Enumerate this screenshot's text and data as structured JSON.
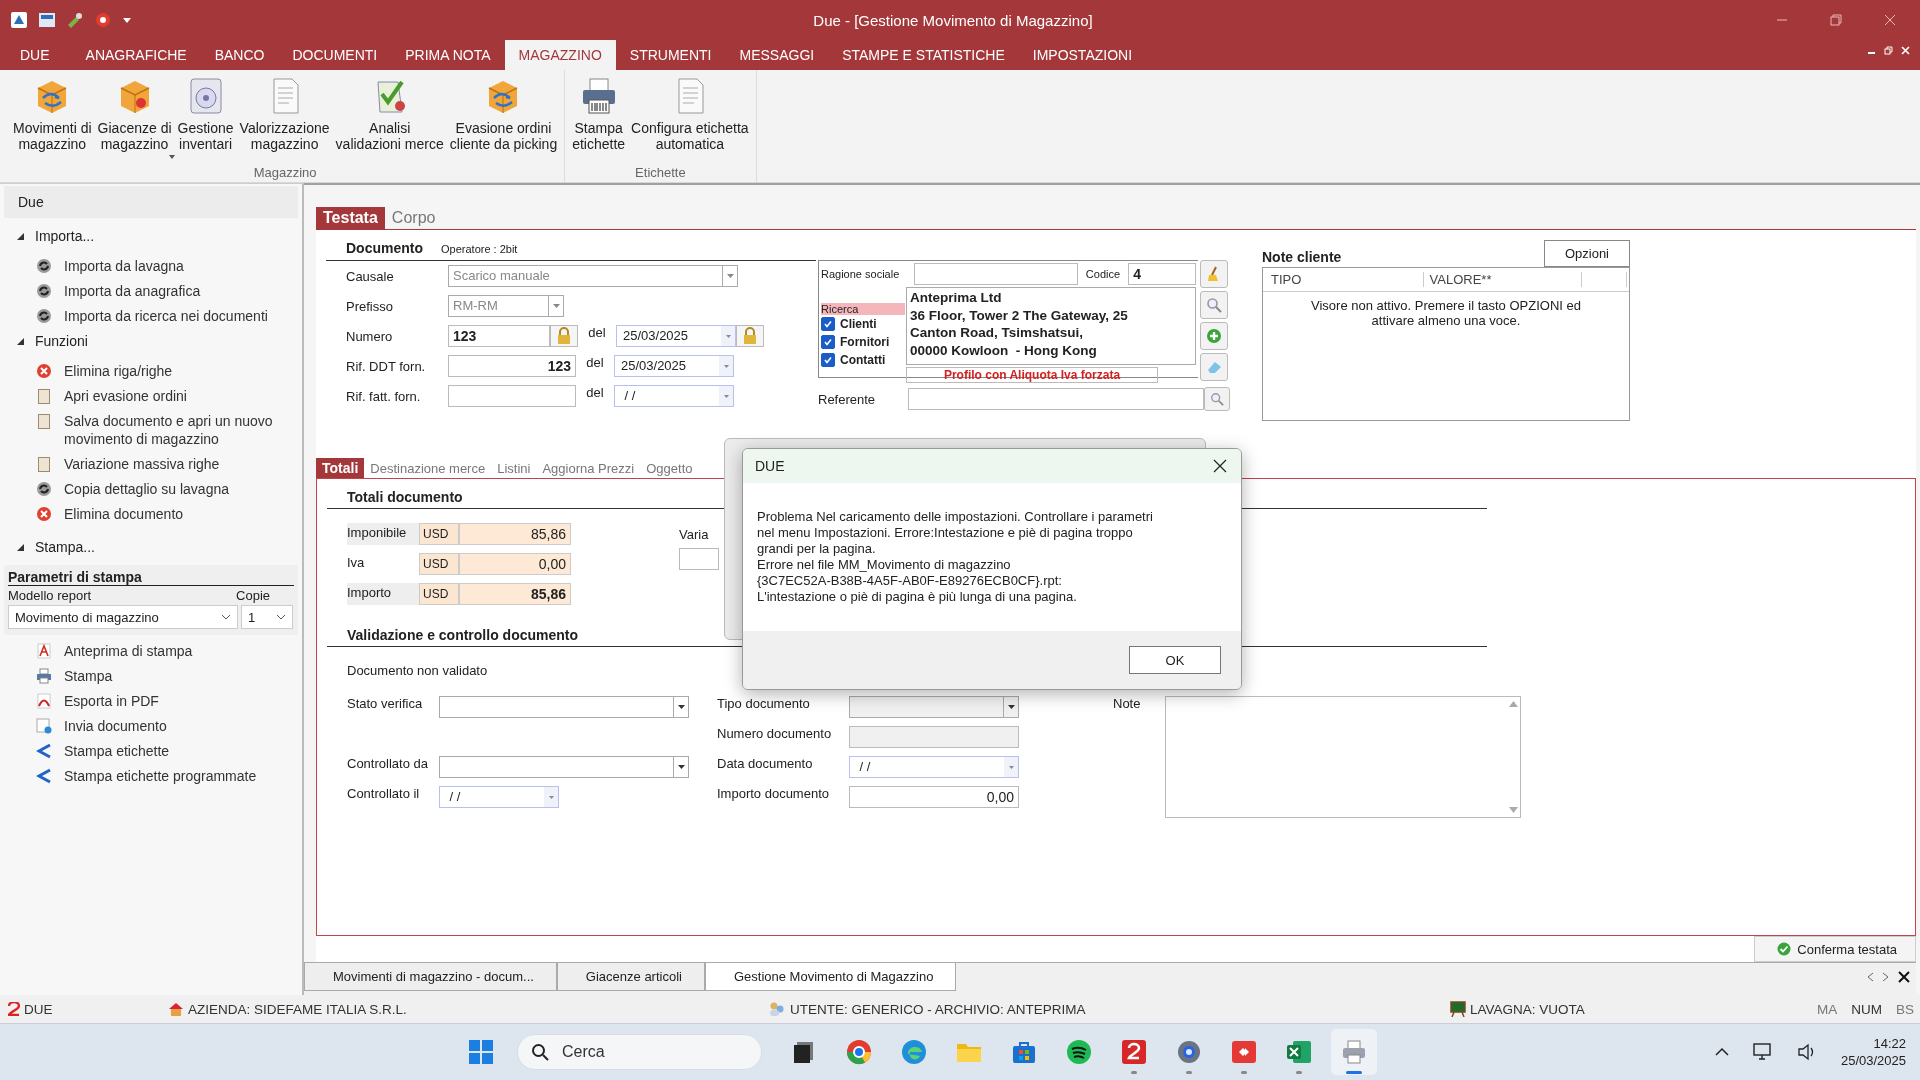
{
  "window": {
    "title": "Due - [Gestione Movimento di Magazzino]"
  },
  "menu_tabs": [
    {
      "label": "DUE",
      "selected": false
    },
    {
      "label": "ANAGRAFICHE",
      "selected": false
    },
    {
      "label": "BANCO",
      "selected": false
    },
    {
      "label": "DOCUMENTI",
      "selected": false
    },
    {
      "label": "PRIMA NOTA",
      "selected": false
    },
    {
      "label": "MAGAZZINO",
      "selected": true
    },
    {
      "label": "STRUMENTI",
      "selected": false
    },
    {
      "label": "MESSAGGI",
      "selected": false
    },
    {
      "label": "STAMPE E STATISTICHE",
      "selected": false
    },
    {
      "label": "IMPOSTAZIONI",
      "selected": false
    }
  ],
  "ribbon": [
    {
      "label": "Magazzino",
      "buttons": [
        {
          "label": "Movimenti di\nmagazzino",
          "kind": "cube"
        },
        {
          "label": "Giacenze di\nmagazzino",
          "kind": "cube-drop"
        },
        {
          "label": "Gestione\ninventari",
          "kind": "disc"
        },
        {
          "label": "Valorizzazione\nmagazzino",
          "kind": "doc"
        },
        {
          "label": "Analisi\nvalidazioni merce",
          "kind": "check"
        },
        {
          "label": "Evasione ordini\ncliente da picking",
          "kind": "cube"
        }
      ]
    },
    {
      "label": "Etichette",
      "buttons": [
        {
          "label": "Stampa\netichette",
          "kind": "printer"
        },
        {
          "label": "Configura etichetta\nautomatica",
          "kind": "doc"
        }
      ]
    }
  ],
  "sidebar": {
    "header": "Due",
    "sections": [
      {
        "label": "Importa...",
        "expanded": true,
        "items": [
          {
            "label": "Importa da lavagna",
            "kind": "sync"
          },
          {
            "label": "Importa da anagrafica",
            "kind": "sync"
          },
          {
            "label": "Importa da ricerca nei documenti",
            "kind": "sync"
          }
        ]
      },
      {
        "label": "Funzioni",
        "expanded": true,
        "items": [
          {
            "label": "Elimina riga/righe",
            "kind": "delete"
          },
          {
            "label": "Apri evasione ordini",
            "kind": "clipboard"
          },
          {
            "label": "Salva documento e apri un nuovo movimento di magazzino",
            "kind": "clipboard"
          },
          {
            "label": "Variazione massiva righe",
            "kind": "clipboard"
          },
          {
            "label": "Copia dettaglio su lavagna",
            "kind": "sync"
          },
          {
            "label": "Elimina documento",
            "kind": "delete"
          }
        ]
      },
      {
        "label": "Stampa...",
        "expanded": true
      }
    ],
    "print_params": {
      "title": "Parametri di stampa",
      "model_label": "Modello report",
      "model": "Movimento di magazzino",
      "copies_label": "Copie",
      "copies": "1"
    },
    "print_items": [
      {
        "label": "Anteprima di stampa",
        "kind": "preview"
      },
      {
        "label": "Stampa",
        "kind": "print"
      },
      {
        "label": "Esporta in PDF",
        "kind": "pdf"
      },
      {
        "label": "Invia documento",
        "kind": "send"
      },
      {
        "label": "Stampa etichette",
        "kind": "label"
      },
      {
        "label": "Stampa etichette programmate",
        "kind": "label"
      }
    ]
  },
  "doc_tabs": [
    {
      "label": "Testata",
      "selected": true
    },
    {
      "label": "Corpo",
      "selected": false
    }
  ],
  "documento": {
    "title": "Documento",
    "operator": "Operatore : 2bit",
    "fields": [
      {
        "label": "Causale",
        "kind": "combo",
        "value": "Scarico manuale"
      },
      {
        "label": "Prefisso",
        "kind": "combo-short",
        "value": "RM-RM"
      },
      {
        "label": "Numero",
        "kind": "locked",
        "value": "123",
        "date_label": "del",
        "date": "25/03/2025"
      },
      {
        "label": "Rif. DDT forn.",
        "kind": "number",
        "value": "123",
        "date_label": "del",
        "date": "25/03/2025"
      },
      {
        "label": "Rif. fatt. forn.",
        "kind": "number",
        "date_label": "del",
        "date": " / /"
      }
    ]
  },
  "customer": {
    "name_label": "Ragione sociale",
    "code_label": "Codice",
    "code": "4",
    "search_label": "Ricerca",
    "filters": [
      {
        "label": "Clienti",
        "checked": true
      },
      {
        "label": "Fornitori",
        "checked": true
      },
      {
        "label": "Contatti",
        "checked": true
      }
    ],
    "address": [
      "Anteprima Ltd",
      "36 Floor, Tower 2 The Gateway, 25",
      "Canton Road, Tsimshatsui,",
      "00000 Kowloon  - Hong Kong"
    ],
    "profile": "Profilo con Aliquota Iva forzata",
    "referente_label": "Referente"
  },
  "note_cliente": {
    "title": "Note cliente",
    "options_button": "Opzioni",
    "columns": [
      "TIPO",
      "VALORE**"
    ],
    "message": "Visore non attivo. Premere il tasto OPZIONI ed attivare almeno una voce."
  },
  "sub_tabs": [
    {
      "label": "Totali",
      "selected": true
    },
    {
      "label": "Destinazione merce",
      "selected": false
    },
    {
      "label": "Listini",
      "selected": false
    },
    {
      "label": "Aggiorna Prezzi",
      "selected": false
    },
    {
      "label": "Oggetto",
      "selected": false
    }
  ],
  "totali": {
    "title": "Totali documento",
    "rows": [
      {
        "label": "Imponibile",
        "currency": "USD",
        "value": "85,86",
        "kind": "plain"
      },
      {
        "label": "Iva",
        "currency": "USD",
        "value": "0,00",
        "kind": "plain"
      },
      {
        "label": "Importo",
        "currency": "USD",
        "value": "85,86",
        "kind": "total"
      }
    ],
    "side_label": "Varia"
  },
  "validazione": {
    "title": "Validazione e controllo documento",
    "status": "Documento non validato",
    "stato_label": "Stato verifica",
    "controllato_da_label": "Controllato da",
    "controllato_il_label": "Controllato il",
    "controllato_il": " / /",
    "tipo_label": "Tipo documento",
    "numero_label": "Numero documento",
    "data_label": "Data documento",
    "data": " / /",
    "importo_label": "Importo documento",
    "importo": "0,00",
    "note_label": "Note"
  },
  "confirm_button": "Conferma testata",
  "open_tabs": [
    {
      "label": "Movimenti di magazzino - docum...",
      "selected": false
    },
    {
      "label": "Giacenze articoli",
      "selected": false
    },
    {
      "label": "Gestione Movimento di Magazzino",
      "selected": true
    }
  ],
  "status_bar": {
    "app": "DUE",
    "company": "AZIENDA: SIDEFAME ITALIA S.R.L.",
    "user": "UTENTE: GENERICO - ARCHIVIO: ANTEPRIMA",
    "board": "LAVAGNA: VUOTA",
    "indicators": [
      "MA",
      "NUM",
      "BS"
    ]
  },
  "dialog": {
    "title": "DUE",
    "lines": [
      "Problema Nel caricamento delle impostazioni. Controllare i parametri",
      "nel menu Impostazioni. Errore:Intestazione e piè di pagina troppo",
      "grandi per la pagina.",
      "Errore nel file MM_Movimento di magazzino",
      "{3C7EC52A-B38B-4A5F-AB0F-E89276ECB0CF}.rpt:",
      "L'intestazione o piè di pagina è più lunga di una pagina."
    ],
    "ok_button": "OK"
  },
  "taskbar": {
    "search_placeholder": "Cerca",
    "time": "14:22",
    "date": "25/03/2025",
    "apps": [
      {
        "kind": "files-stack",
        "running": false,
        "selected": false
      },
      {
        "kind": "chrome",
        "running": false,
        "selected": false
      },
      {
        "kind": "edge",
        "running": false,
        "selected": false
      },
      {
        "kind": "folder",
        "running": false,
        "selected": false
      },
      {
        "kind": "store",
        "running": false,
        "selected": false
      },
      {
        "kind": "spotify",
        "running": false,
        "selected": false
      },
      {
        "kind": "due",
        "running": true,
        "selected": false
      },
      {
        "kind": "gear",
        "running": true,
        "selected": false
      },
      {
        "kind": "remote",
        "running": true,
        "selected": false
      },
      {
        "kind": "excel",
        "running": true,
        "selected": false
      },
      {
        "kind": "printer",
        "running": true,
        "selected": true
      }
    ]
  }
}
